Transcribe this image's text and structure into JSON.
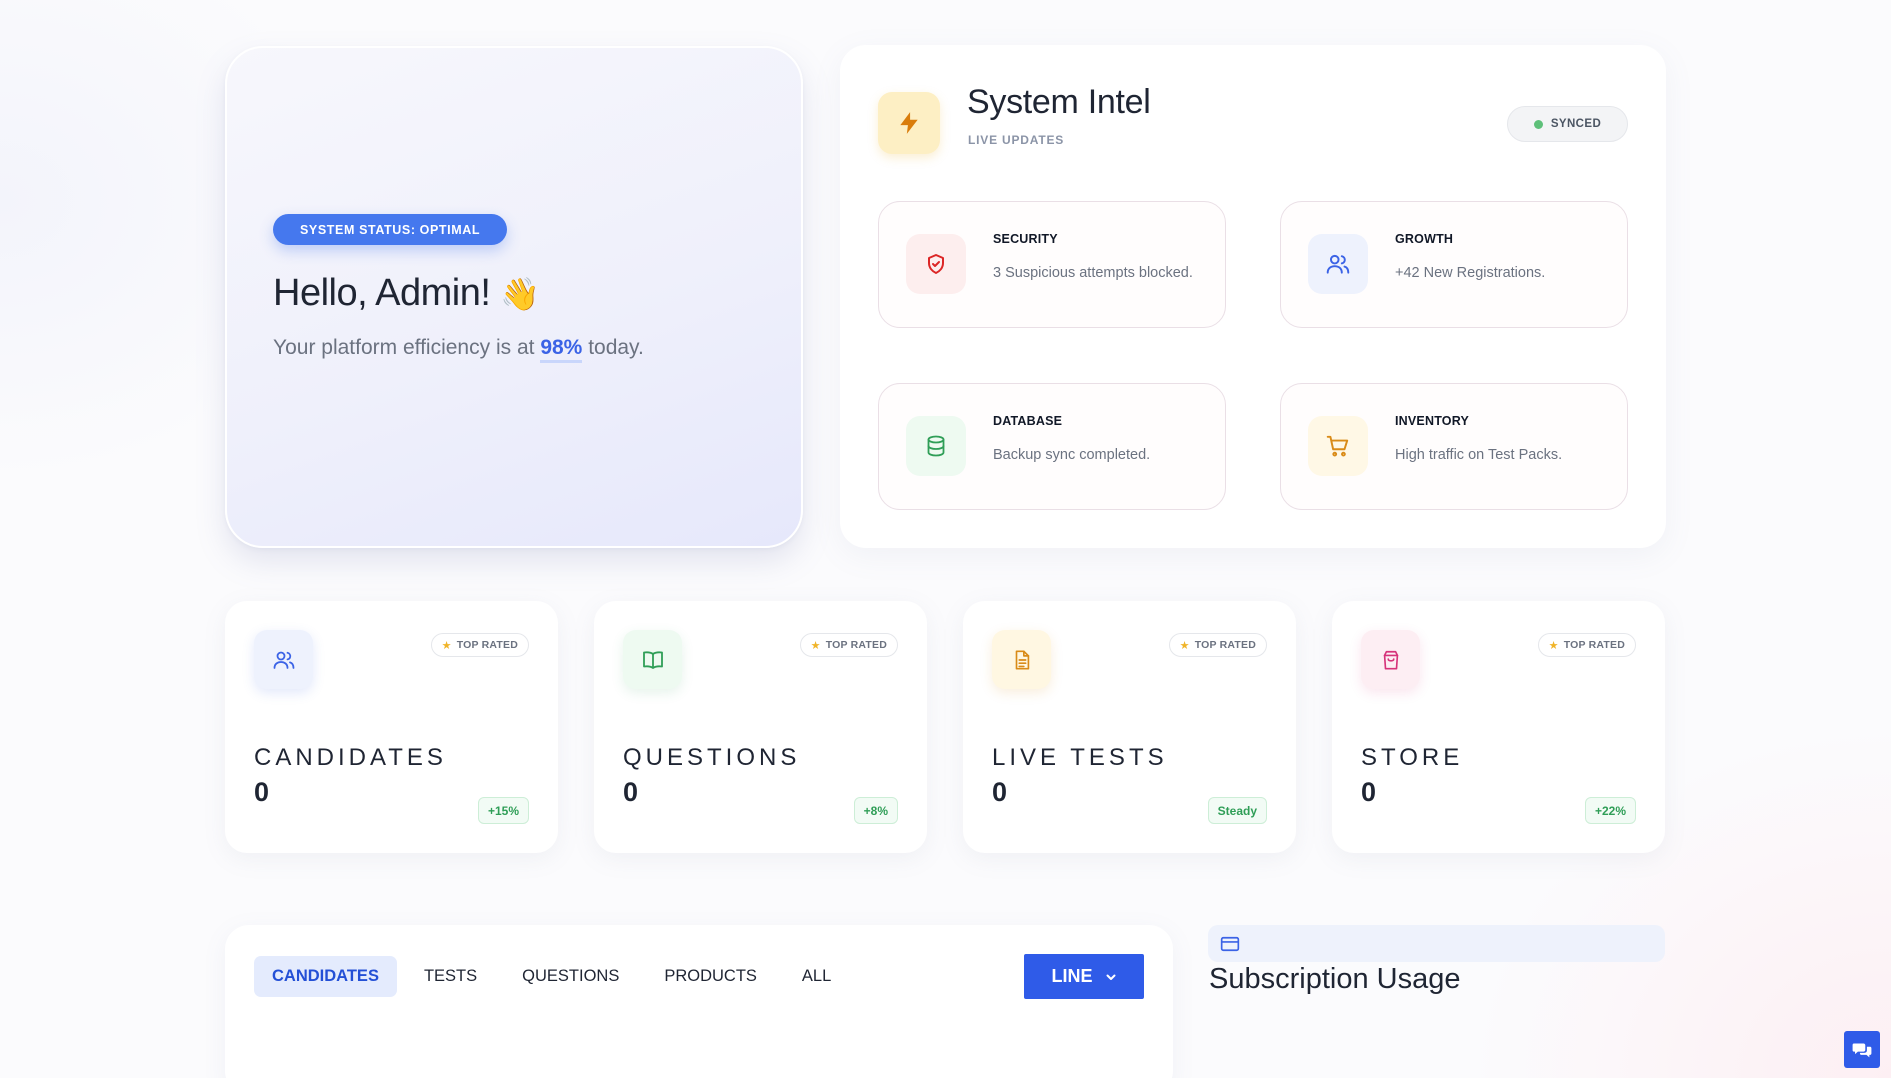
{
  "hero": {
    "status_pill": "SYSTEM STATUS: OPTIMAL",
    "greeting": "Hello, Admin!",
    "wave_emoji": "👋",
    "subtitle_prefix": "Your platform efficiency is at",
    "efficiency": "98%",
    "subtitle_suffix": "today."
  },
  "intel": {
    "icon": "lightning-icon",
    "title": "System Intel",
    "subtitle": "LIVE UPDATES",
    "sync_status": "SYNCED",
    "cards": [
      {
        "title": "SECURITY",
        "desc": "3 Suspicious attempts blocked.",
        "icon": "shield-check-icon",
        "color": "#dc2626"
      },
      {
        "title": "GROWTH",
        "desc": "+42 New Registrations.",
        "icon": "users-icon",
        "color": "#3b63e6"
      },
      {
        "title": "DATABASE",
        "desc": "Backup sync completed.",
        "icon": "database-icon",
        "color": "#2f9e57"
      },
      {
        "title": "INVENTORY",
        "desc": "High traffic on Test Packs.",
        "icon": "cart-icon",
        "color": "#d98b18"
      }
    ]
  },
  "stats": [
    {
      "label": "CANDIDATES",
      "value": "0",
      "badge": "TOP RATED",
      "delta": "+15%",
      "icon": "users-icon",
      "color": "#3b63e6"
    },
    {
      "label": "QUESTIONS",
      "value": "0",
      "badge": "TOP RATED",
      "delta": "+8%",
      "icon": "book-icon",
      "color": "#2f9e57"
    },
    {
      "label": "LIVE TESTS",
      "value": "0",
      "badge": "TOP RATED",
      "delta": "Steady",
      "icon": "document-icon",
      "color": "#d98b18"
    },
    {
      "label": "STORE",
      "value": "0",
      "badge": "TOP RATED",
      "delta": "+22%",
      "icon": "shopping-bag-icon",
      "color": "#d6337a"
    }
  ],
  "chart_panel": {
    "tabs": [
      "CANDIDATES",
      "TESTS",
      "QUESTIONS",
      "PRODUCTS",
      "ALL"
    ],
    "active_tab": "CANDIDATES",
    "chart_type_button": "LINE"
  },
  "subscription": {
    "title": "Subscription Usage",
    "icon": "credit-card-icon"
  },
  "colors": {
    "accent": "#2f5be8",
    "pill": "#4578ee",
    "success": "#2f9e57"
  }
}
